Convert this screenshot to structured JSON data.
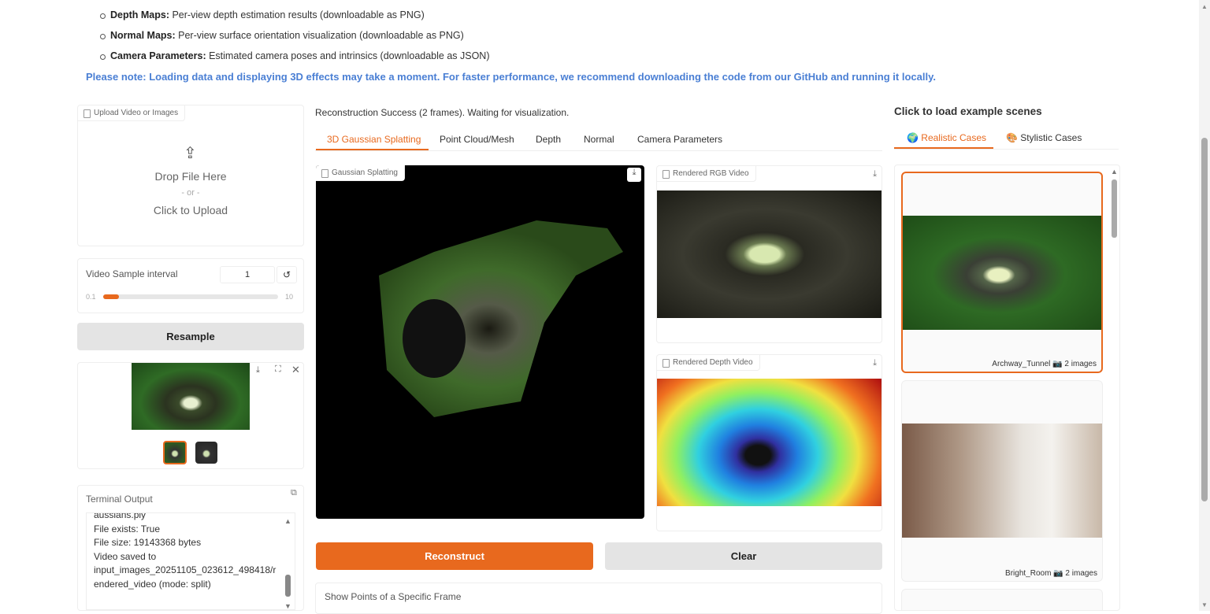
{
  "intro": {
    "bullets": [
      {
        "term": "Depth Maps:",
        "text": " Per-view depth estimation results (downloadable as PNG)"
      },
      {
        "term": "Normal Maps:",
        "text": " Per-view surface orientation visualization (downloadable as PNG)"
      },
      {
        "term": "Camera Parameters:",
        "text": " Estimated camera poses and intrinsics (downloadable as JSON)"
      }
    ],
    "note": "Please note: Loading data and displaying 3D effects may take a moment. For faster performance, we recommend downloading the code from our GitHub and running it locally."
  },
  "upload": {
    "label": "Upload Video or Images",
    "drop": "Drop File Here",
    "or": "- or -",
    "click": "Click to Upload"
  },
  "slider": {
    "label": "Video Sample interval",
    "value": "1",
    "min": "0.1",
    "max": "10",
    "fraction": 0.09
  },
  "resample": "Resample",
  "terminal": {
    "label": "Terminal Output",
    "lines": [
      "aussians.ply",
      "File exists: True",
      "File size: 19143368 bytes",
      "Video saved to",
      "input_images_20251105_023612_498418/r",
      "endered_video (mode: split)"
    ]
  },
  "status": "Reconstruction Success (2 frames). Waiting for visualization.",
  "tabs": [
    "3D Gaussian Splatting",
    "Point Cloud/Mesh",
    "Depth",
    "Normal",
    "Camera Parameters"
  ],
  "viewer_label": "Gaussian Splatting",
  "rgb_label": "Rendered RGB Video",
  "depth_label": "Rendered Depth Video",
  "reconstruct": "Reconstruct",
  "clear": "Clear",
  "show_points": "Show Points of a Specific Frame",
  "examples": {
    "title": "Click to load example scenes",
    "tabs": [
      "Realistic Cases",
      "Stylistic Cases"
    ],
    "items": [
      {
        "name": "Archway_Tunnel",
        "count": "2 images"
      },
      {
        "name": "Bright_Room",
        "count": "2 images"
      }
    ]
  },
  "colors": {
    "accent": "#e8691e",
    "note": "#4a7fd4"
  }
}
